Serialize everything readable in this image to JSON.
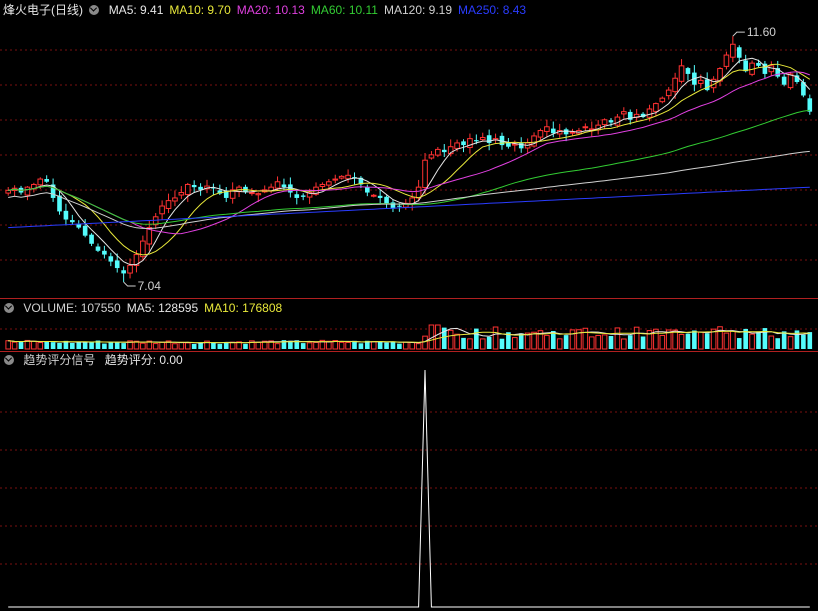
{
  "main_panel": {
    "stock_label": "烽火电子(日线)",
    "indicators": [
      {
        "label": "MA5: 9.41",
        "color": "#e6e6e6"
      },
      {
        "label": "MA10: 9.70",
        "color": "#e8e83a"
      },
      {
        "label": "MA20: 10.13",
        "color": "#e040e0"
      },
      {
        "label": "MA60: 10.11",
        "color": "#33cc33"
      },
      {
        "label": "MA120: 9.19",
        "color": "#d0d0d0"
      },
      {
        "label": "MA250: 8.43",
        "color": "#2a3cff"
      }
    ],
    "high_marker": "11.60",
    "low_marker": "7.04"
  },
  "volume_panel": {
    "indicators": [
      {
        "label": "VOLUME: 107550",
        "color": "#d0d0d0"
      },
      {
        "label": "MA5: 128595",
        "color": "#e6e6e6"
      },
      {
        "label": "MA10: 176808",
        "color": "#e8e83a"
      }
    ]
  },
  "signal_panel": {
    "title": "趋势评分信号",
    "score_label": "趋势评分: 0.00"
  },
  "colors": {
    "up": "#ff3232",
    "down": "#54fcfc",
    "grid": "#7a1010",
    "ma5": "#e6e6e6",
    "ma10": "#e8e83a",
    "ma20": "#e040e0",
    "ma60": "#33cc33",
    "ma120": "#d0d0d0",
    "ma250": "#2a3cff"
  },
  "chart_data": [
    {
      "type": "candlestick",
      "series_name": "烽火电子(日线)",
      "ylim": [
        6.8,
        11.9
      ],
      "high": 11.6,
      "low": 7.04,
      "closes": [
        8.74,
        8.78,
        8.7,
        8.8,
        8.85,
        8.95,
        8.9,
        8.6,
        8.35,
        8.2,
        8.15,
        8.05,
        7.9,
        7.75,
        7.62,
        7.55,
        7.42,
        7.3,
        7.2,
        7.35,
        7.55,
        7.8,
        8.05,
        8.25,
        8.45,
        8.55,
        8.6,
        8.7,
        8.85,
        8.8,
        8.75,
        8.82,
        8.78,
        8.68,
        8.6,
        8.75,
        8.8,
        8.72,
        8.7,
        8.68,
        8.75,
        8.8,
        8.9,
        8.8,
        8.7,
        8.6,
        8.62,
        8.7,
        8.8,
        8.85,
        8.9,
        8.95,
        9.0,
        9.02,
        8.98,
        8.85,
        8.7,
        8.65,
        8.6,
        8.5,
        8.4,
        8.45,
        8.5,
        8.6,
        8.8,
        9.3,
        9.4,
        9.5,
        9.45,
        9.55,
        9.62,
        9.58,
        9.7,
        9.65,
        9.72,
        9.62,
        9.7,
        9.58,
        9.55,
        9.6,
        9.52,
        9.62,
        9.75,
        9.85,
        9.92,
        9.8,
        9.85,
        9.78,
        9.82,
        9.85,
        9.92,
        9.88,
        9.95,
        10.05,
        10.0,
        10.1,
        10.2,
        10.05,
        10.15,
        10.1,
        10.25,
        10.35,
        10.45,
        10.6,
        10.82,
        11.05,
        10.9,
        10.7,
        10.78,
        10.6,
        10.8,
        11.0,
        11.25,
        11.45,
        11.2,
        10.95,
        11.1,
        11.05,
        10.9,
        11.05,
        10.85,
        10.7,
        10.9,
        10.75,
        10.5,
        10.2
      ]
    },
    {
      "type": "bar",
      "series_name": "VOLUME",
      "values": [
        107550
      ]
    },
    {
      "type": "line",
      "series_name": "趋势评分",
      "ylim": [
        0,
        1
      ],
      "peak_index": 65,
      "last_value": 0.0
    }
  ]
}
